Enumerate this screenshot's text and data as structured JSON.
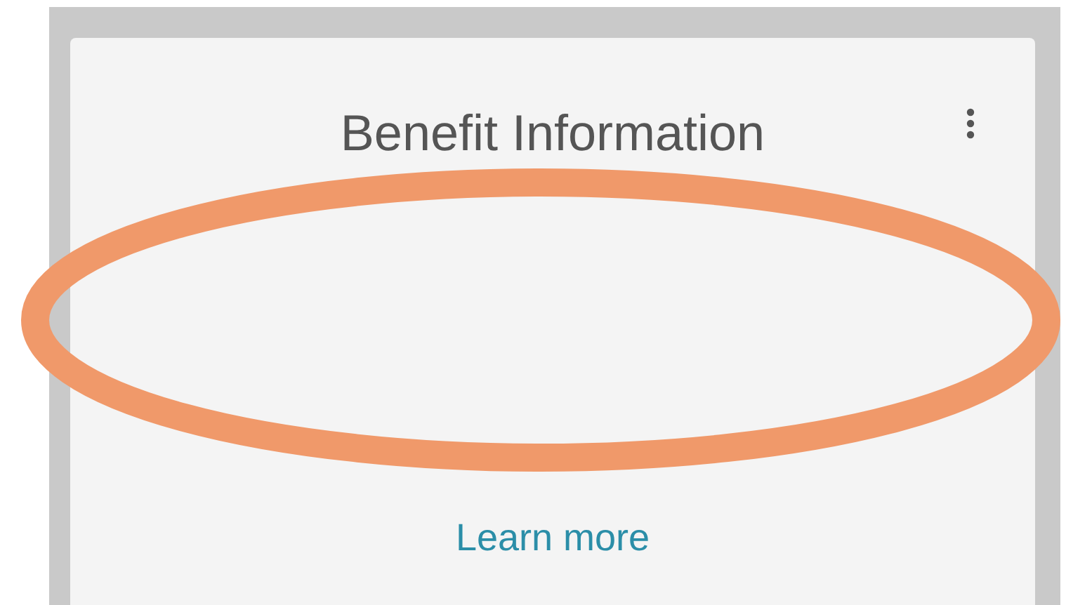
{
  "card": {
    "title": "Benefit Information",
    "link": "Learn more"
  }
}
